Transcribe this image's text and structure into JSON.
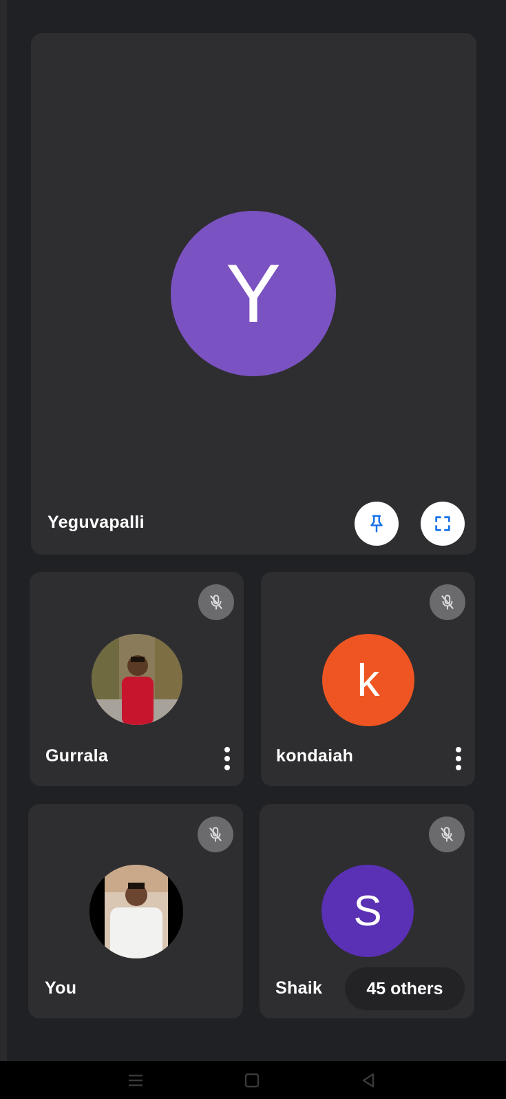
{
  "participants": {
    "main": {
      "name": "Yeguvapalli",
      "initial": "Y",
      "avatar_color": "#7b52c1"
    },
    "gurrala": {
      "name": "Gurrala",
      "muted": true
    },
    "kondaiah": {
      "name": "kondaiah",
      "initial": "k",
      "avatar_color": "#ef5522",
      "muted": true
    },
    "you": {
      "name": "You",
      "muted": true
    },
    "shaik": {
      "name": "Shaik",
      "initial": "S",
      "avatar_color": "#5a30b4",
      "muted": true,
      "others_label": "45 others"
    }
  },
  "icons": {
    "pin": "pin-icon",
    "fullscreen": "fullscreen-icon",
    "mic_off": "mic-off-icon",
    "more": "more-vert-icon"
  },
  "colors": {
    "background": "#202124",
    "tile": "#2e2e31",
    "accent": "#1a73e8"
  }
}
